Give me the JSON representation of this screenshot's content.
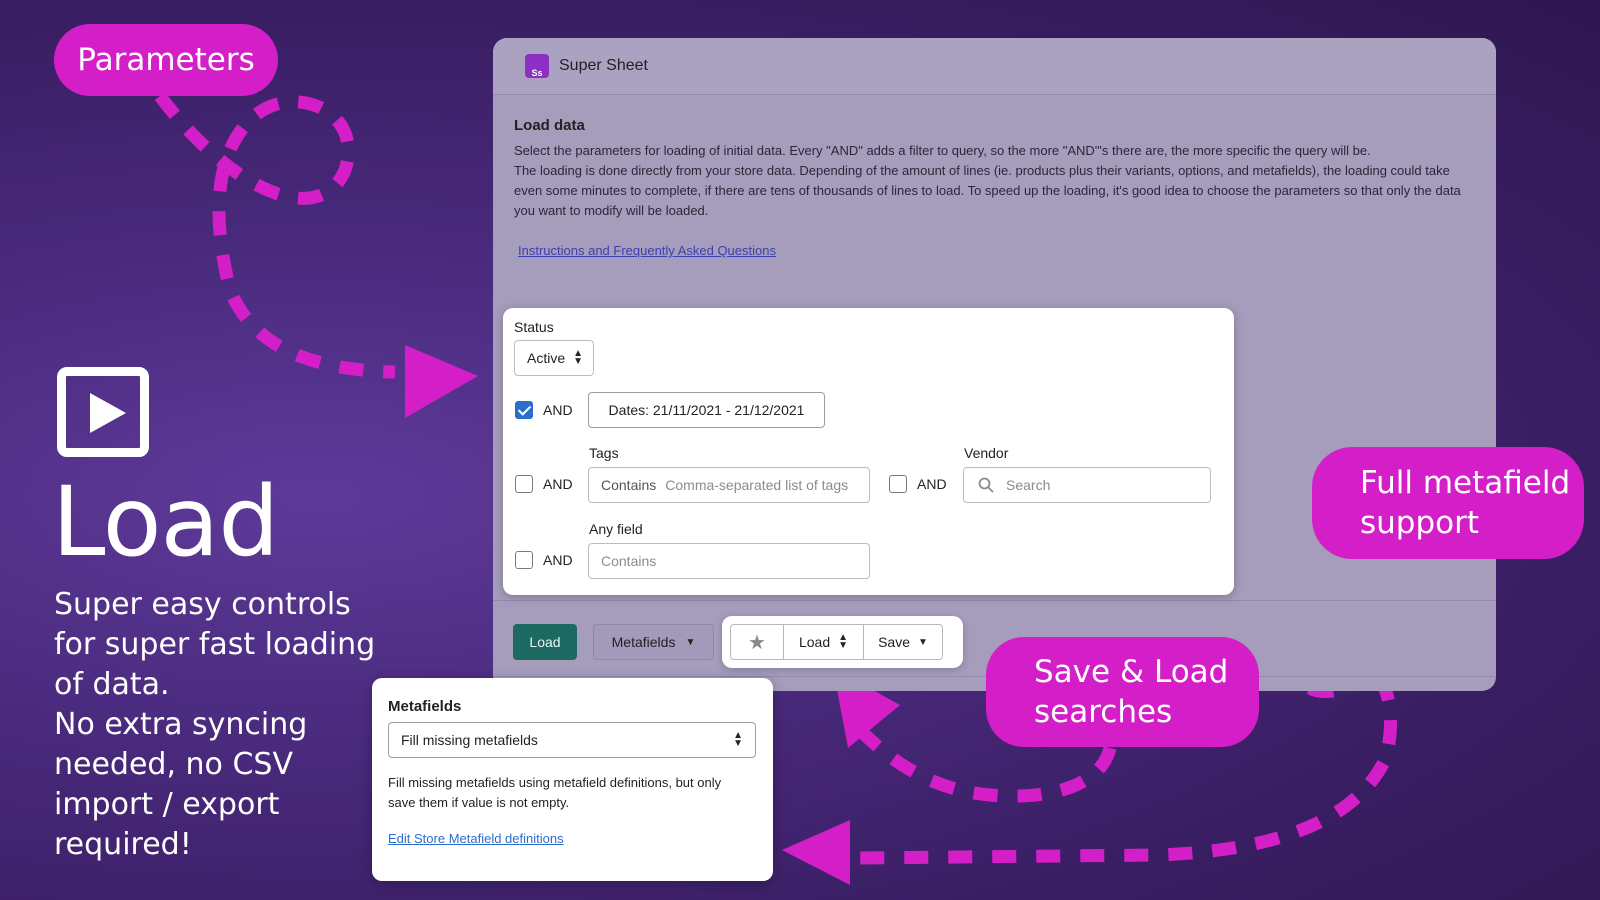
{
  "bubbles": {
    "parameters": "Parameters",
    "metafield_support": "Full metafield\nsupport",
    "save_load": "Save & Load\nsearches"
  },
  "hero": {
    "heading": "Load",
    "description": "Super easy controls for super fast loading of data.\nNo extra syncing needed, no CSV import / export required!"
  },
  "app": {
    "title": "Super Sheet",
    "logo_text": "Ss",
    "section_title": "Load data",
    "paragraph1": "Select the parameters for loading of initial data. Every \"AND\" adds a filter to query, so the more \"AND\"'s there are, the more specific the query will be.",
    "paragraph2": "The loading is done directly from your store data. Depending of the amount of lines (ie. products plus their variants, options, and metafields), the loading could take even some minutes to complete, if there are tens of thousands of lines to load. To speed up the loading, it's good idea to choose the parameters so that only the data you want to modify will be loaded.",
    "faq_link": "Instructions and Frequently Asked Questions",
    "load_button": "Load",
    "metafields_button": "Metafields"
  },
  "params": {
    "status_label": "Status",
    "status_value": "Active",
    "and_label": "AND",
    "dates_button": "Dates: 21/11/2021 - 21/12/2021",
    "tags_label": "Tags",
    "tags_prefix": "Contains",
    "tags_placeholder": "Comma-separated list of tags",
    "vendor_label": "Vendor",
    "vendor_placeholder": "Search",
    "anyfield_label": "Any field",
    "anyfield_placeholder": "Contains",
    "checkboxes": {
      "dates": true,
      "tags": false,
      "vendor": false,
      "anyfield": false
    }
  },
  "favorites": {
    "load_label": "Load",
    "save_label": "Save"
  },
  "metafields_popup": {
    "title": "Metafields",
    "selected": "Fill missing metafields",
    "description": "Fill missing metafields using metafield definitions, but only save them if value is not empty.",
    "link": "Edit Store Metafield definitions"
  },
  "colors": {
    "accent_magenta": "#d41fc8",
    "primary_button": "#1d6a63",
    "checkbox_blue": "#2c6ecb"
  }
}
